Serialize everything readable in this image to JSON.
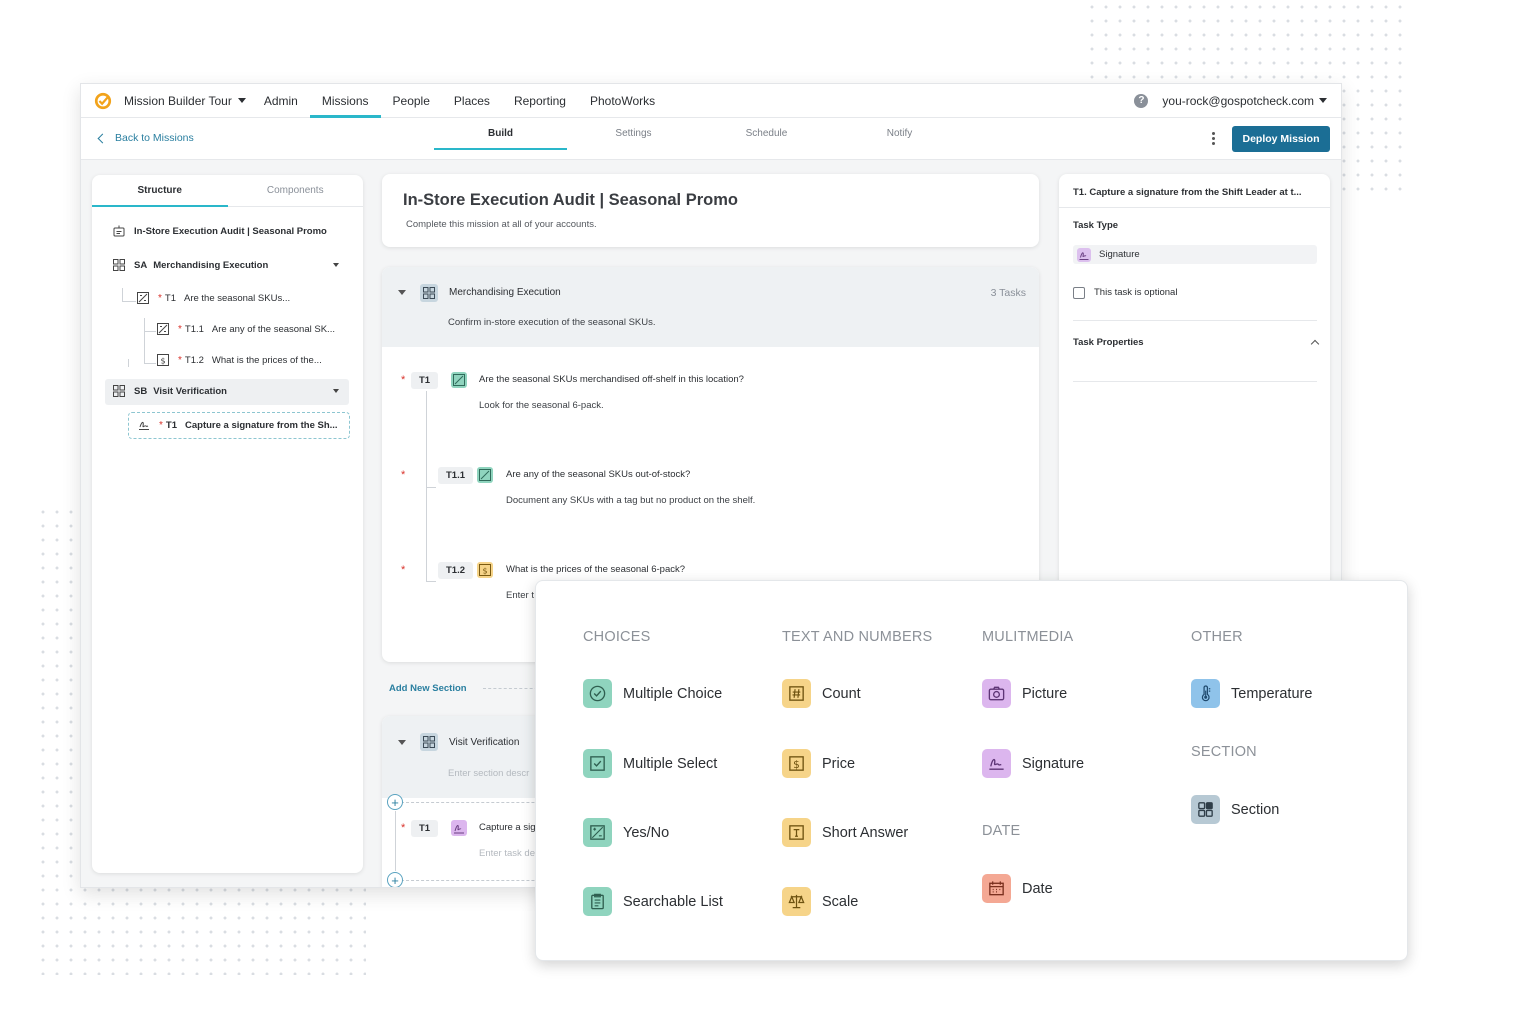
{
  "topnav": {
    "brand": "Mission Builder Tour",
    "items": [
      "Admin",
      "Missions",
      "People",
      "Places",
      "Reporting",
      "PhotoWorks"
    ],
    "active": "Missions",
    "account": "you-rock@gospotcheck.com"
  },
  "subbar": {
    "back": "Back to Missions",
    "tabs": [
      "Build",
      "Settings",
      "Schedule",
      "Notify"
    ],
    "active_tab": "Build",
    "deploy": "Deploy Mission"
  },
  "left_panel": {
    "tabs": [
      "Structure",
      "Components"
    ],
    "active_tab": "Structure",
    "mission": "In-Store Execution Audit | Seasonal Promo",
    "section_a": {
      "code": "SA",
      "name": "Merchandising Execution"
    },
    "t1": {
      "code": "T1",
      "text": "Are the seasonal SKUs..."
    },
    "t11": {
      "code": "T1.1",
      "text": "Are any of the seasonal SK..."
    },
    "t12": {
      "code": "T1.2",
      "text": "What is the prices of the..."
    },
    "section_b": {
      "code": "SB",
      "name": "Visit Verification"
    },
    "sb_t1": {
      "code": "T1",
      "text": "Capture a signature from the Sh..."
    }
  },
  "mission": {
    "title": "In-Store Execution Audit | Seasonal Promo",
    "desc": "Complete this mission at all of your accounts."
  },
  "section_a": {
    "name": "Merchandising Execution",
    "count": "3 Tasks",
    "desc": "Confirm in-store execution of the seasonal SKUs.",
    "tasks": [
      {
        "num": "T1",
        "q": "Are the seasonal SKUs merchandised off-shelf in this location?",
        "hint": "Look for the seasonal 6-pack."
      },
      {
        "num": "T1.1",
        "q": "Are any of the seasonal SKUs out-of-stock?",
        "hint": "Document any SKUs with a tag but no product on the shelf."
      },
      {
        "num": "T1.2",
        "q": "What is the prices of the seasonal 6-pack?",
        "hint": "Enter t"
      }
    ]
  },
  "add_section": "Add New Section",
  "section_b": {
    "name": "Visit Verification",
    "desc_placeholder": "Enter section descr",
    "task": {
      "num": "T1",
      "q": "Capture a sig",
      "placeholder": "Enter task de"
    }
  },
  "right_panel": {
    "title": "T1. Capture a signature from the Shift Leader at t...",
    "task_type_label": "Task Type",
    "task_type": "Signature",
    "optional": "This task is optional",
    "properties": "Task Properties"
  },
  "components": {
    "choices": {
      "title": "CHOICES",
      "items": [
        "Multiple Choice",
        "Multiple Select",
        "Yes/No",
        "Searchable List"
      ]
    },
    "text_numbers": {
      "title": "TEXT AND NUMBERS",
      "items": [
        "Count",
        "Price",
        "Short Answer",
        "Scale"
      ]
    },
    "multimedia": {
      "title": "MULITMEDIA",
      "items": [
        "Picture",
        "Signature"
      ]
    },
    "date": {
      "title": "DATE",
      "items": [
        "Date"
      ]
    },
    "other": {
      "title": "OTHER",
      "items": [
        "Temperature"
      ]
    },
    "section": {
      "title": "SECTION",
      "items": [
        "Section"
      ]
    }
  },
  "colors": {
    "accent": "#2ab7ca",
    "primary_button": "#1b6e95",
    "link": "#2a7fa0",
    "required": "#d9322b"
  }
}
